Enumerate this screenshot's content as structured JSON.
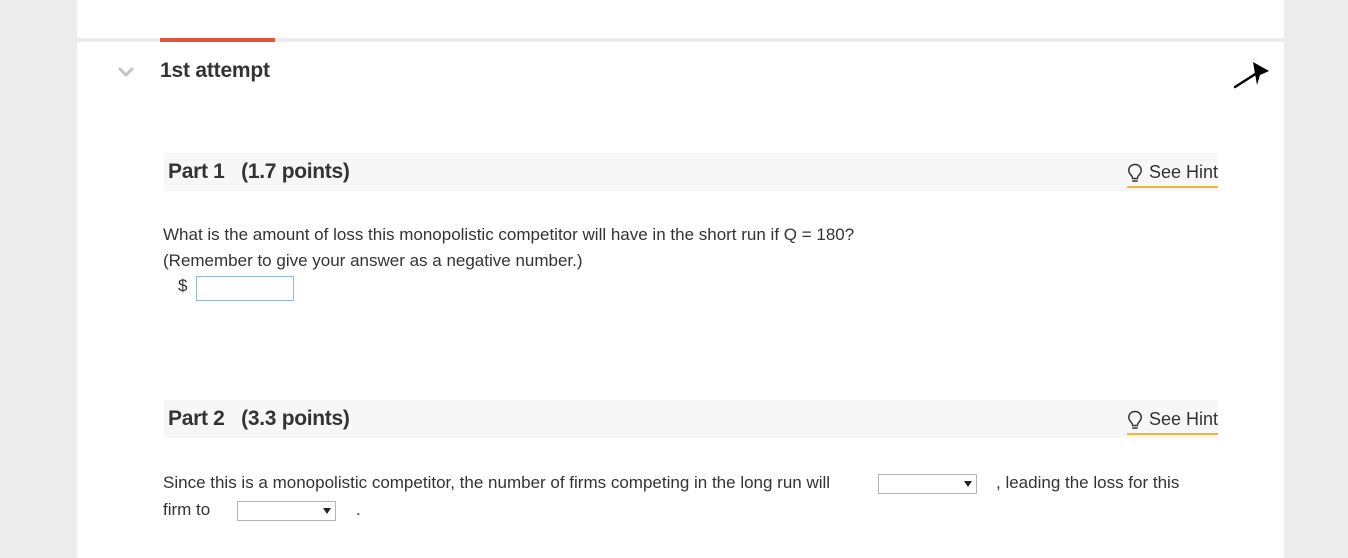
{
  "attempt": {
    "title": "1st attempt"
  },
  "colors": {
    "accent": "#e0553a",
    "hint_underline": "#f0b53a",
    "input_border": "#8fb8e0"
  },
  "parts": [
    {
      "label": "Part 1   (1.7 points)",
      "hint_label": "See Hint",
      "question_line1": "What is the amount of loss this monopolistic competitor will have in the short run if Q = 180?",
      "question_line2": "(Remember to give your answer as a negative number.)",
      "currency_symbol": "$",
      "answer_value": ""
    },
    {
      "label": "Part 2   (3.3 points)",
      "hint_label": "See Hint",
      "text_a": "Since this is a monopolistic competitor, the number of firms competing in the long run will",
      "text_b": ", leading the loss for this",
      "text_c": "firm to",
      "text_end": ".",
      "dropdown1_value": "",
      "dropdown2_value": ""
    }
  ],
  "icons": {
    "collapse": "chevron-down-icon",
    "pin": "pin-icon",
    "hint": "lightbulb-icon",
    "dropdown": "caret-down-icon"
  }
}
